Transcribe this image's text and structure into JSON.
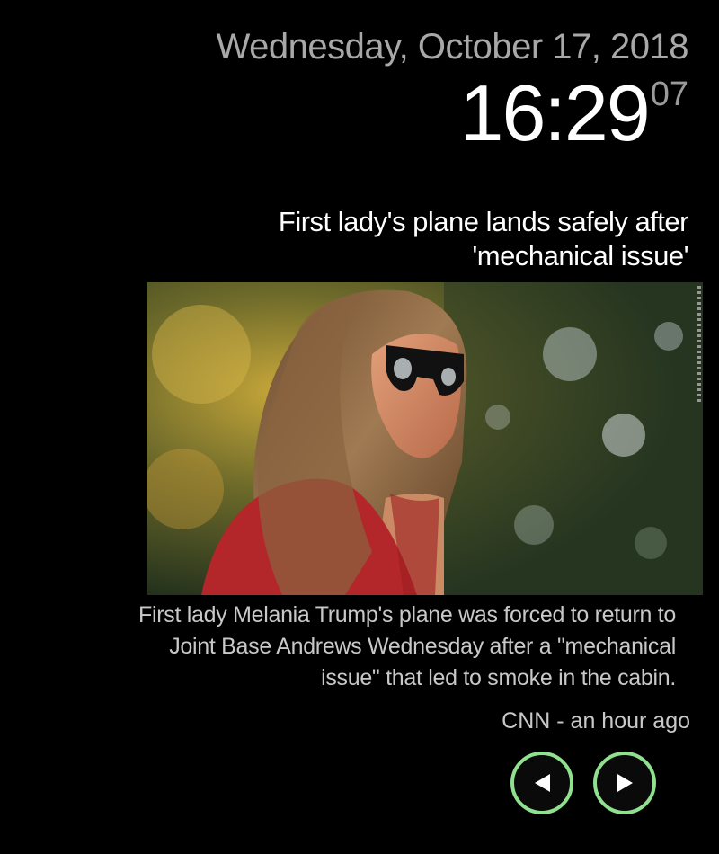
{
  "clock": {
    "date": "Wednesday, October 17, 2018",
    "time": "16:29",
    "seconds": "07"
  },
  "article": {
    "headline": "First lady's plane lands safely after 'mechanical issue'",
    "summary": "First lady Melania Trump's plane was forced to return to Joint Base Andrews Wednesday after a \"mechanical issue\" that led to smoke in the cabin.",
    "source_line": "CNN - an hour ago"
  },
  "navigation": {
    "previous_icon": "triangle-left-icon",
    "next_icon": "triangle-right-icon",
    "accent_color": "#8fe08f"
  }
}
